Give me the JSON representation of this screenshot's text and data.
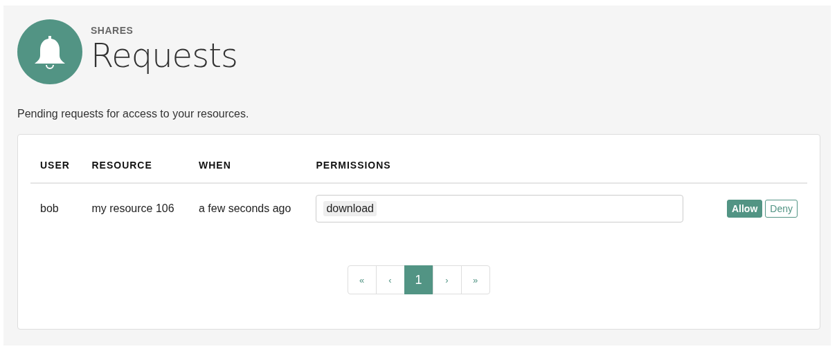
{
  "header": {
    "section": "SHARES",
    "title": "Requests"
  },
  "description": "Pending requests for access to your resources.",
  "table": {
    "columns": [
      "USER",
      "RESOURCE",
      "WHEN",
      "PERMISSIONS"
    ],
    "rows": [
      {
        "user": "bob",
        "resource": "my resource 106",
        "when": "a few seconds ago",
        "permissions": [
          "download"
        ],
        "actions": [
          {
            "label": "Allow",
            "kind": "primary"
          },
          {
            "label": "Deny",
            "kind": "outline"
          }
        ]
      }
    ]
  },
  "pagination": [
    {
      "label": "«",
      "selected": false
    },
    {
      "label": "‹",
      "selected": false
    },
    {
      "label": "1",
      "selected": true
    },
    {
      "label": "›",
      "selected": false
    },
    {
      "label": "»",
      "selected": false
    }
  ]
}
